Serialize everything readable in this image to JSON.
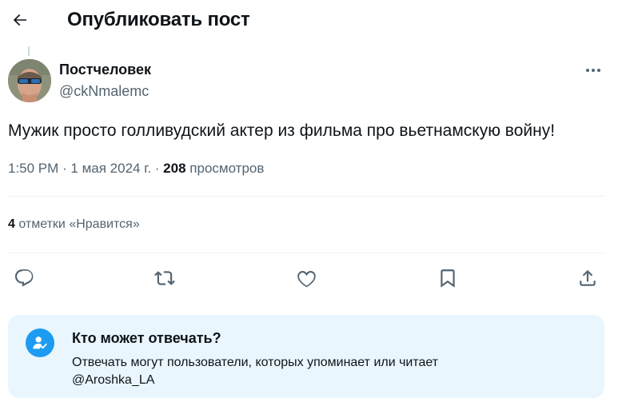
{
  "header": {
    "title": "Опубликовать пост",
    "back_icon": "arrow-left-icon"
  },
  "author": {
    "name": "Постчеловек",
    "handle": "@ckNmalemc",
    "avatar_icon": "avatar-photo",
    "more_icon": "more-horizontal-icon"
  },
  "post": {
    "text": "Мужик просто голливудский актер из фильма про вьетнамскую войну!",
    "time": "1:50 PM",
    "separator": " · ",
    "date": "1 мая 2024 г.",
    "views_count": "208",
    "views_label": "просмотров"
  },
  "engagement": {
    "likes_count": "4",
    "likes_label": "отметки «Нравится»"
  },
  "actions": [
    {
      "name": "reply",
      "icon": "comment-icon"
    },
    {
      "name": "repost",
      "icon": "repost-icon"
    },
    {
      "name": "like",
      "icon": "heart-icon"
    },
    {
      "name": "bookmark",
      "icon": "bookmark-icon"
    },
    {
      "name": "share",
      "icon": "share-icon"
    }
  ],
  "reply_restriction": {
    "icon": "user-check-icon",
    "title": "Кто может отвечать?",
    "description": "Отвечать могут пользователи, которых упоминает или читает",
    "mention": "@Aroshka_LA"
  },
  "colors": {
    "text": "#0f1419",
    "secondary": "#536471",
    "accent": "#1d9bf0",
    "info_bg": "#e9f6fd",
    "divider": "#eff3f4"
  }
}
